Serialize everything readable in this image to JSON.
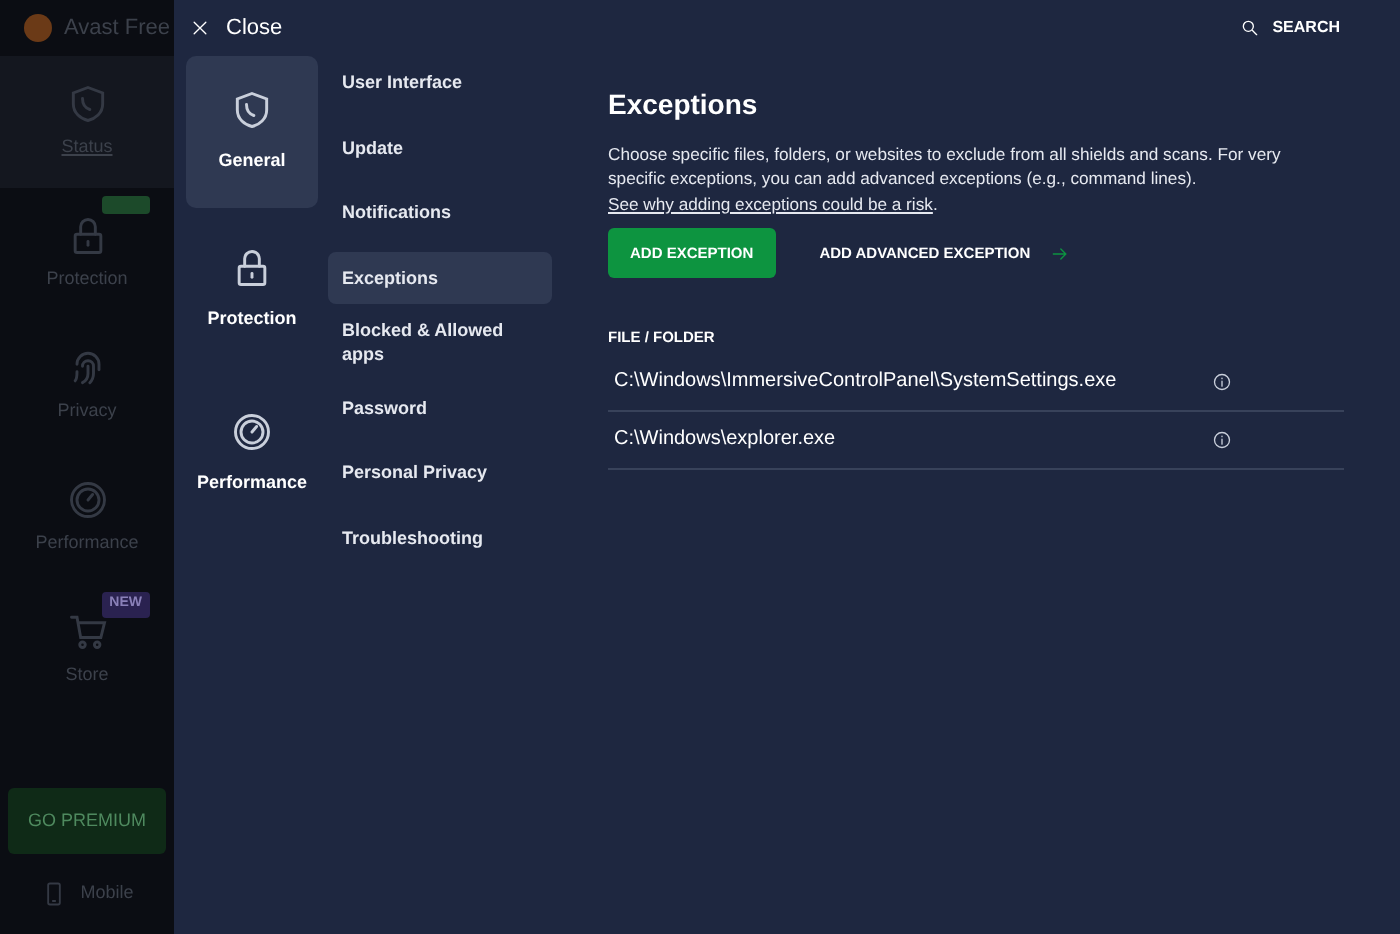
{
  "background_app": {
    "title": "Avast Free",
    "nav": [
      {
        "label": "Status",
        "selected": true
      },
      {
        "label": "Protection",
        "selected": false,
        "tag": {
          "color": "#1c4a2a"
        }
      },
      {
        "label": "Privacy",
        "selected": false
      },
      {
        "label": "Performance",
        "selected": false
      },
      {
        "label": "Store",
        "selected": false,
        "tag": {
          "text": "NEW",
          "color": "#2a2250"
        }
      }
    ],
    "premium_button": "GO PREMIUM",
    "mobile": "Mobile"
  },
  "header": {
    "close": "Close",
    "search": "SEARCH"
  },
  "categories": [
    {
      "label": "General",
      "selected": true
    },
    {
      "label": "Protection",
      "selected": false
    },
    {
      "label": "Performance",
      "selected": false
    }
  ],
  "subitems": [
    {
      "label": "User Interface",
      "selected": false
    },
    {
      "label": "Update",
      "selected": false
    },
    {
      "label": "Notifications",
      "selected": false
    },
    {
      "label": "Exceptions",
      "selected": true
    },
    {
      "label": "Blocked & Allowed apps",
      "selected": false
    },
    {
      "label": "Password",
      "selected": false
    },
    {
      "label": "Personal Privacy",
      "selected": false
    },
    {
      "label": "Troubleshooting",
      "selected": false
    }
  ],
  "content": {
    "title": "Exceptions",
    "description": "Choose specific files, folders, or websites to exclude from all shields and scans. For very specific exceptions, you can add advanced exceptions (e.g., command lines).",
    "link": "See why adding exceptions could be a risk",
    "link_suffix": ".",
    "primary_button": "ADD EXCEPTION",
    "secondary_button": "ADD ADVANCED EXCEPTION",
    "table": {
      "column": "FILE / FOLDER",
      "rows": [
        "C:\\Windows\\ImmersiveControlPanel\\SystemSettings.exe",
        "C:\\Windows\\explorer.exe"
      ]
    }
  }
}
